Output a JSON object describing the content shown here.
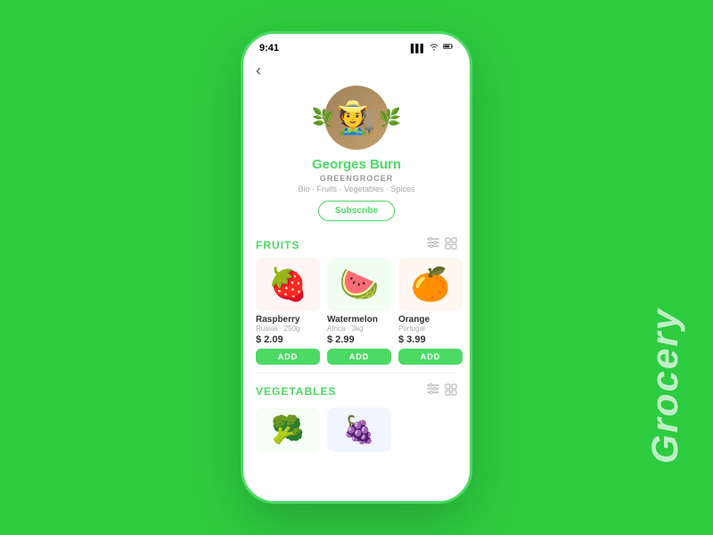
{
  "background": "#2ecc40",
  "grocery_label": "Grocery",
  "status_bar": {
    "time": "9:41",
    "signal_icon": "▌▌▌",
    "wifi_icon": "wifi",
    "battery_icon": "battery"
  },
  "back_button": "‹",
  "profile": {
    "name": "Georges Burn",
    "role": "GREENGROCER",
    "tags": "Bio · Fruits · Vegetables · Spices",
    "subscribe_label": "Subscribe"
  },
  "fruits_section": {
    "title": "FRUITS",
    "products": [
      {
        "emoji": "🍓",
        "name": "Raspberry",
        "origin": "Russia · 250g",
        "price": "$ 2.09",
        "add_label": "ADD"
      },
      {
        "emoji": "🍉",
        "name": "Watermelon",
        "origin": "Africa · 3kg",
        "price": "$ 2.99",
        "add_label": "ADD"
      },
      {
        "emoji": "🍊",
        "name": "Orange",
        "origin": "Portugal",
        "price": "$ 3.99",
        "add_label": "ADD"
      }
    ]
  },
  "vegetables_section": {
    "title": "VEGETABLES",
    "products": [
      {
        "emoji": "🥦"
      },
      {
        "emoji": "🍇"
      }
    ]
  }
}
